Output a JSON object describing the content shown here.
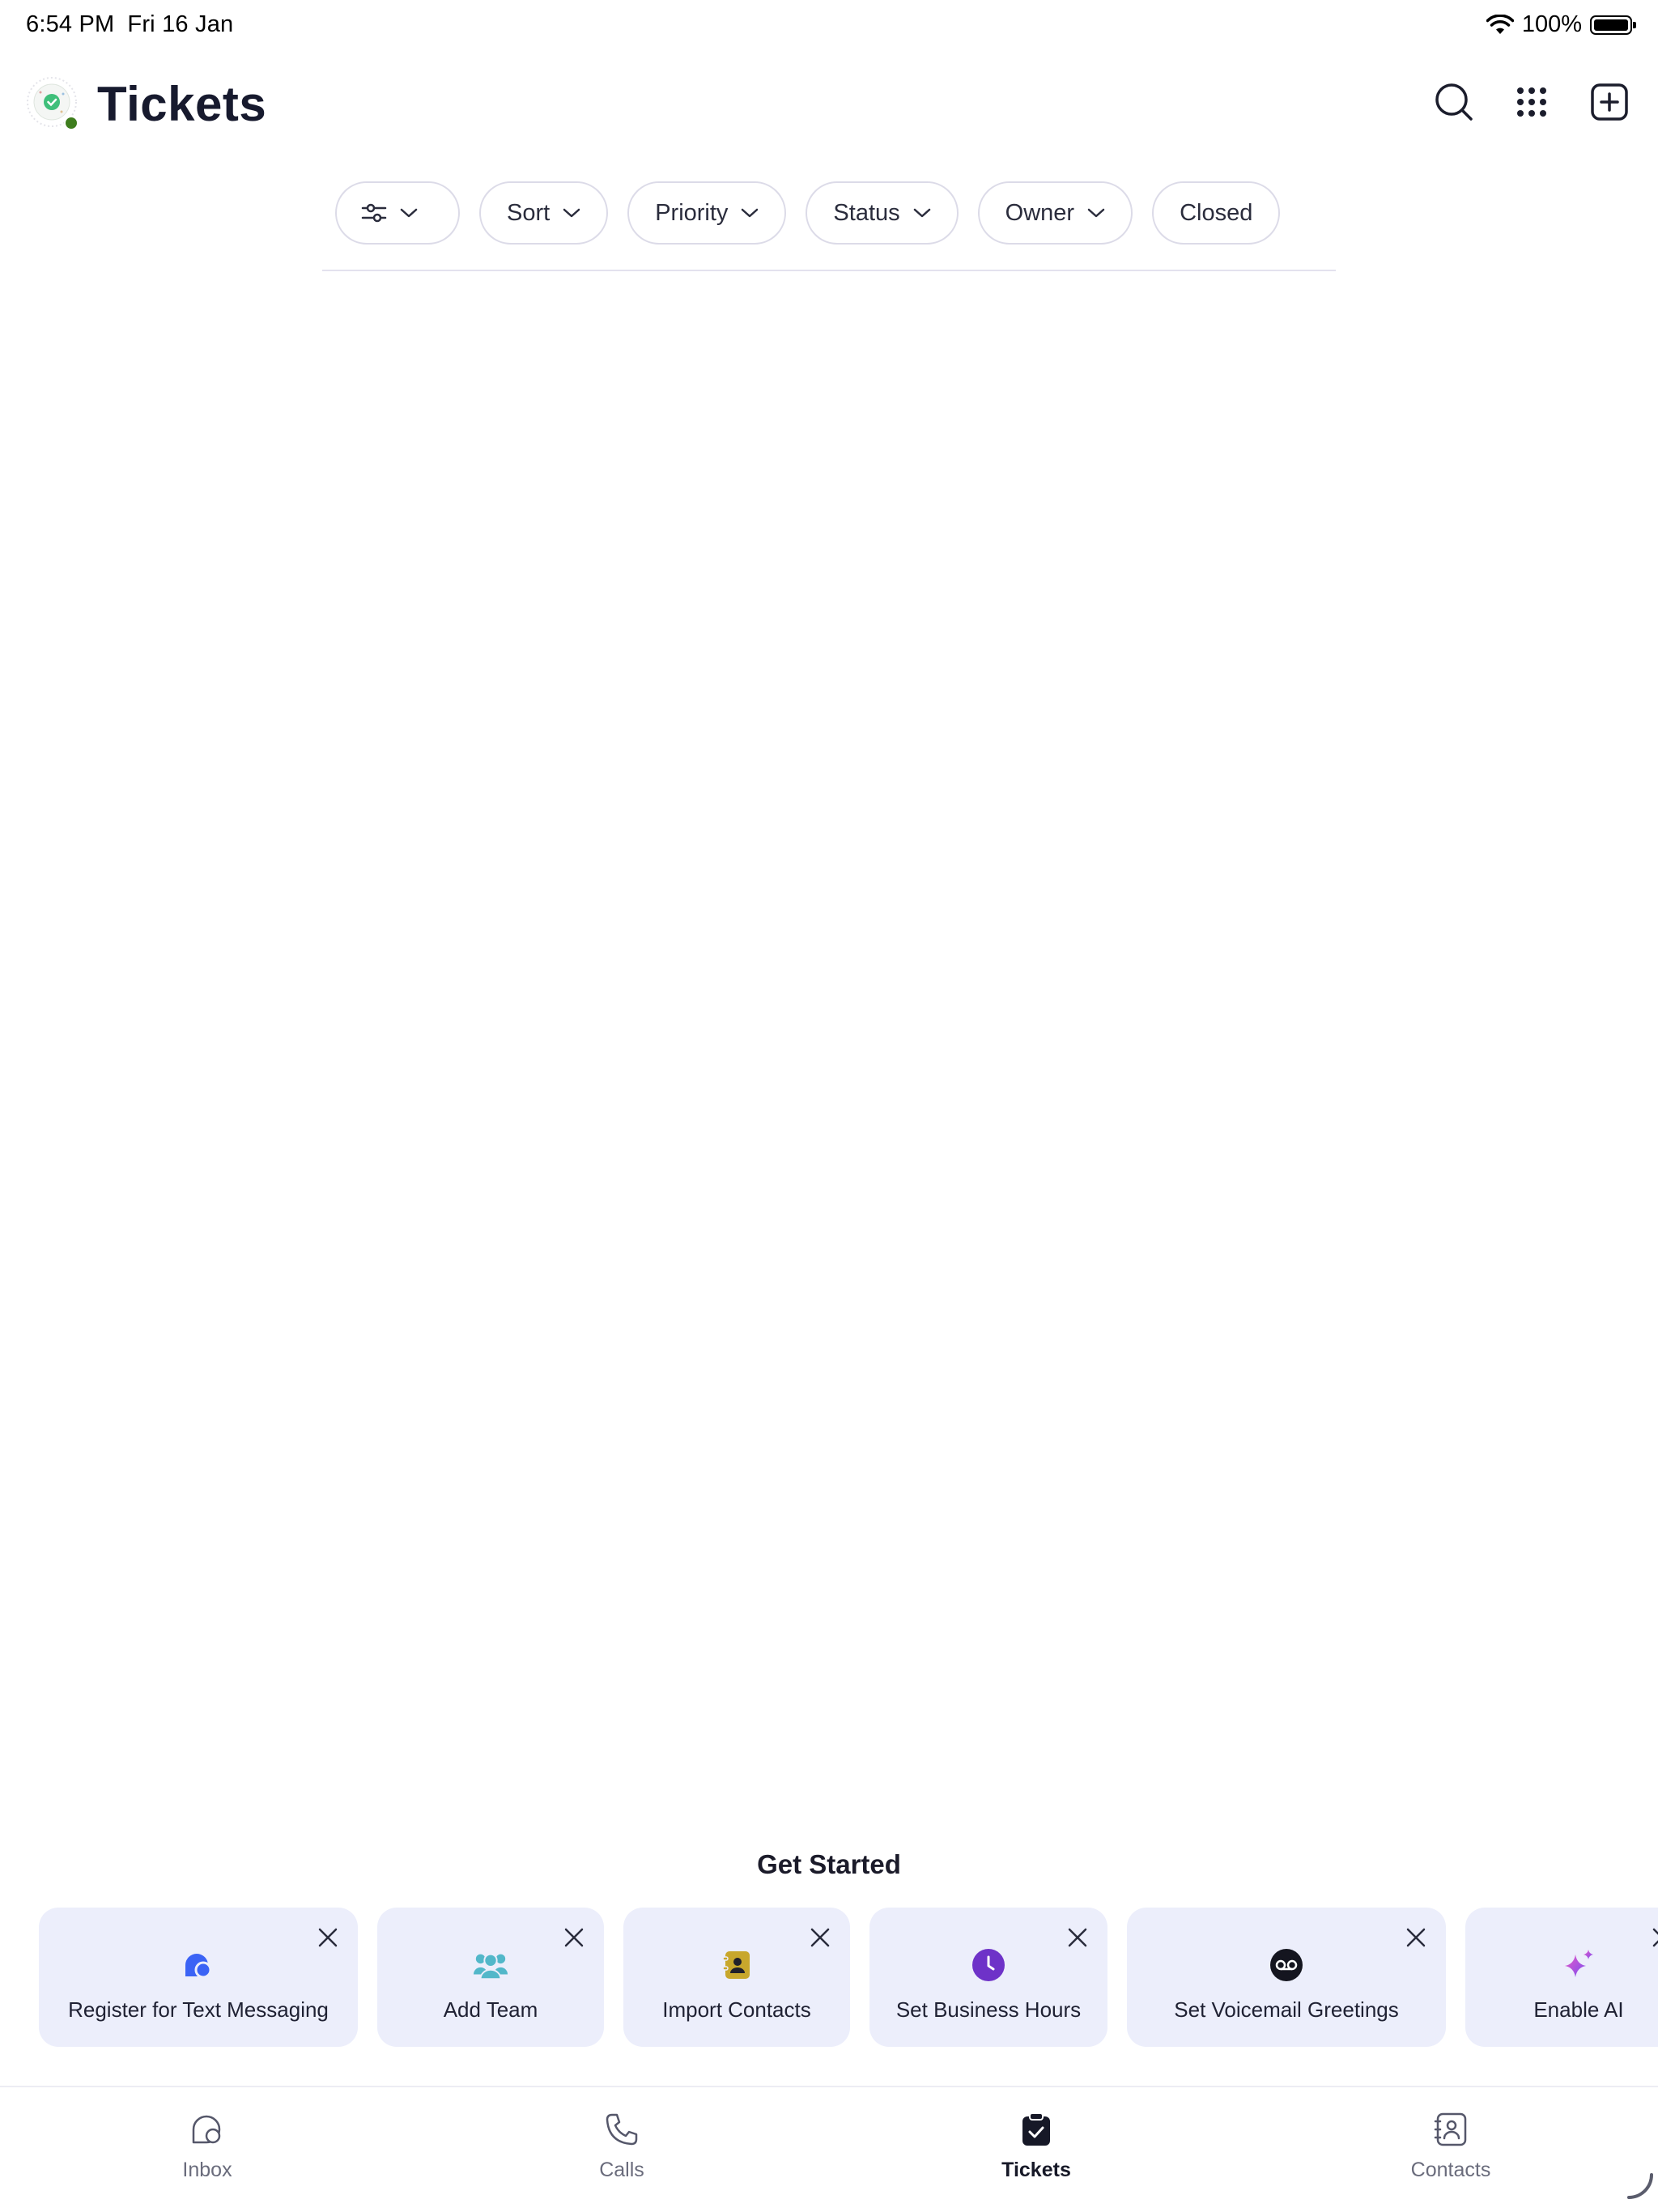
{
  "status_bar": {
    "time": "6:54 PM",
    "date": "Fri 16 Jan",
    "battery": "100%"
  },
  "header": {
    "title": "Tickets",
    "actions": [
      "search-icon",
      "dialpad-icon",
      "new-ticket-icon"
    ],
    "avatar_status_color": "#3e7d1d"
  },
  "filters": {
    "sort": "Sort",
    "priority": "Priority",
    "status": "Status",
    "owner": "Owner",
    "closed": "Closed"
  },
  "get_started": {
    "title": "Get Started",
    "cards": [
      {
        "label": "Register for Text Messaging",
        "icon": "chat-bubble-icon",
        "color": "#3b63f5"
      },
      {
        "label": "Add Team",
        "icon": "team-icon",
        "color": "#52b7c9"
      },
      {
        "label": "Import Contacts",
        "icon": "contact-book-icon",
        "color": "#c8a72c"
      },
      {
        "label": "Set Business Hours",
        "icon": "clock-icon",
        "color": "#6e32c8"
      },
      {
        "label": "Set Voicemail Greetings",
        "icon": "voicemail-icon",
        "color": "#14151f"
      },
      {
        "label": "Enable AI",
        "icon": "sparkle-icon",
        "color": "#b64fe0"
      }
    ]
  },
  "tabbar": {
    "items": [
      {
        "label": "Inbox",
        "icon": "inbox-chat-icon"
      },
      {
        "label": "Calls",
        "icon": "phone-icon"
      },
      {
        "label": "Tickets",
        "icon": "clipboard-check-icon",
        "active": true
      },
      {
        "label": "Contacts",
        "icon": "contact-card-icon"
      }
    ]
  },
  "colors": {
    "accent_card_bg": "#eceefb",
    "title_text": "#171a2e"
  }
}
